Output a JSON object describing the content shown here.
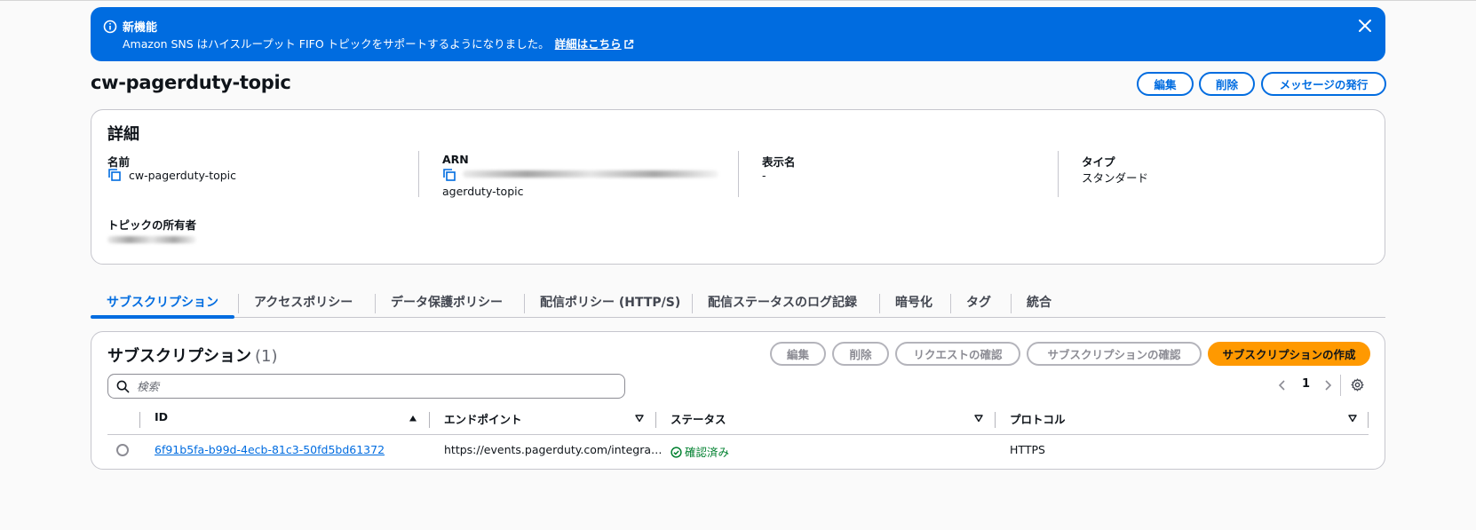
{
  "flash": {
    "title": "新機能",
    "message": "Amazon SNS はハイスループット FIFO トピックをサポートするようになりました。",
    "link_label": "詳細はこちら"
  },
  "header": {
    "title": "cw-pagerduty-topic",
    "edit_label": "編集",
    "delete_label": "削除",
    "publish_label": "メッセージの発行"
  },
  "details": {
    "heading": "詳細",
    "name_label": "名前",
    "name_value": "cw-pagerduty-topic",
    "arn_label": "ARN",
    "arn_value_visible": "agerduty-topic",
    "display_name_label": "表示名",
    "display_name_value": "-",
    "type_label": "タイプ",
    "type_value": "スタンダード",
    "owner_label": "トピックの所有者"
  },
  "tabs": [
    {
      "label": "サブスクリプション",
      "active": true
    },
    {
      "label": "アクセスポリシー"
    },
    {
      "label": "データ保護ポリシー"
    },
    {
      "label": "配信ポリシー (HTTP/S)"
    },
    {
      "label": "配信ステータスのログ記録"
    },
    {
      "label": "暗号化"
    },
    {
      "label": "タグ"
    },
    {
      "label": "統合"
    }
  ],
  "subscriptions": {
    "heading": "サブスクリプション",
    "count": "(1)",
    "edit_label": "編集",
    "delete_label": "削除",
    "request_confirm_label": "リクエストの確認",
    "confirm_sub_label": "サブスクリプションの確認",
    "create_label": "サブスクリプションの作成",
    "search_placeholder": "検索",
    "page": "1",
    "columns": [
      "ID",
      "エンドポイント",
      "ステータス",
      "プロトコル"
    ],
    "rows": [
      {
        "id": "6f91b5fa-b99d-4ecb-81c3-50fd5bd61372",
        "endpoint": "https://events.pagerduty.com/integra…",
        "status": "確認済み",
        "protocol": "HTTPS"
      }
    ]
  },
  "colors": {
    "accent": "#006ce0",
    "primary_button": "#ff9900",
    "success": "#00802f"
  },
  "icons": [
    "info-icon",
    "close-icon",
    "external-link-icon",
    "copy-icon",
    "search-icon",
    "chevron-left-icon",
    "chevron-right-icon",
    "gear-icon",
    "sort-ascending-icon",
    "sort-icon",
    "status-success-icon"
  ]
}
